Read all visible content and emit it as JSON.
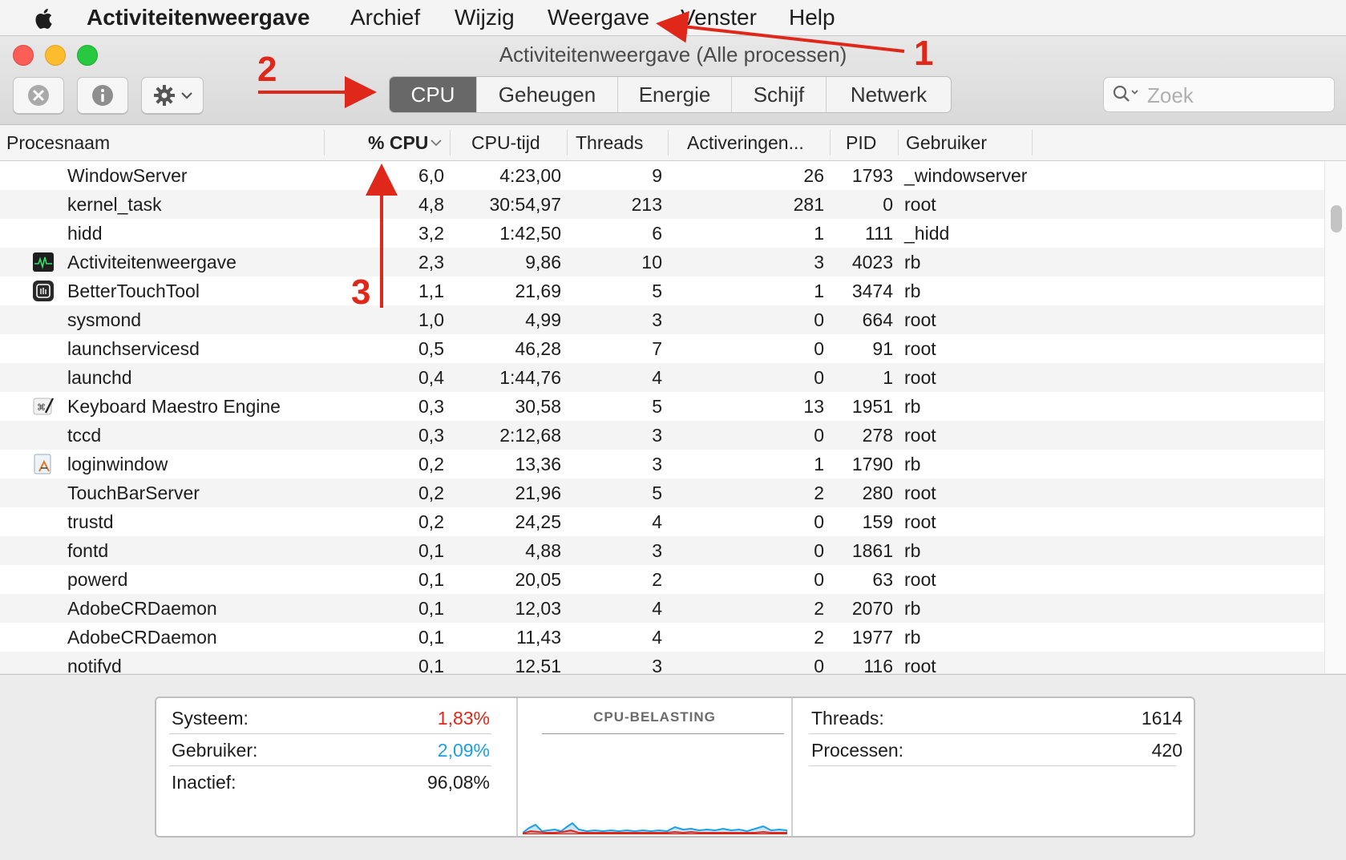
{
  "menubar": {
    "app_name": "Activiteitenweergave",
    "items": [
      "Archief",
      "Wijzig",
      "Weergave",
      "Venster",
      "Help"
    ]
  },
  "window": {
    "title": "Activiteitenweergave (Alle processen)",
    "tabs": [
      {
        "label": "CPU",
        "active": true
      },
      {
        "label": "Geheugen",
        "active": false
      },
      {
        "label": "Energie",
        "active": false
      },
      {
        "label": "Schijf",
        "active": false
      },
      {
        "label": "Netwerk",
        "active": false
      }
    ],
    "search_placeholder": "Zoek"
  },
  "table": {
    "columns": [
      "Procesnaam",
      "% CPU",
      "CPU-tijd",
      "Threads",
      "Activeringen...",
      "PID",
      "Gebruiker"
    ],
    "rows": [
      {
        "name": "WindowServer",
        "cpu": "6,0",
        "time": "4:23,00",
        "threads": "9",
        "wakeups": "26",
        "pid": "1793",
        "user": "_windowserver",
        "icon": ""
      },
      {
        "name": "kernel_task",
        "cpu": "4,8",
        "time": "30:54,97",
        "threads": "213",
        "wakeups": "281",
        "pid": "0",
        "user": "root",
        "icon": ""
      },
      {
        "name": "hidd",
        "cpu": "3,2",
        "time": "1:42,50",
        "threads": "6",
        "wakeups": "1",
        "pid": "111",
        "user": "_hidd",
        "icon": ""
      },
      {
        "name": "Activiteitenweergave",
        "cpu": "2,3",
        "time": "9,86",
        "threads": "10",
        "wakeups": "3",
        "pid": "4023",
        "user": "rb",
        "icon": "activity-monitor-icon"
      },
      {
        "name": "BetterTouchTool",
        "cpu": "1,1",
        "time": "21,69",
        "threads": "5",
        "wakeups": "1",
        "pid": "3474",
        "user": "rb",
        "icon": "bettertouchtool-icon"
      },
      {
        "name": "sysmond",
        "cpu": "1,0",
        "time": "4,99",
        "threads": "3",
        "wakeups": "0",
        "pid": "664",
        "user": "root",
        "icon": ""
      },
      {
        "name": "launchservicesd",
        "cpu": "0,5",
        "time": "46,28",
        "threads": "7",
        "wakeups": "0",
        "pid": "91",
        "user": "root",
        "icon": ""
      },
      {
        "name": "launchd",
        "cpu": "0,4",
        "time": "1:44,76",
        "threads": "4",
        "wakeups": "0",
        "pid": "1",
        "user": "root",
        "icon": ""
      },
      {
        "name": "Keyboard Maestro Engine",
        "cpu": "0,3",
        "time": "30,58",
        "threads": "5",
        "wakeups": "13",
        "pid": "1951",
        "user": "rb",
        "icon": "keyboard-maestro-icon"
      },
      {
        "name": "tccd",
        "cpu": "0,3",
        "time": "2:12,68",
        "threads": "3",
        "wakeups": "0",
        "pid": "278",
        "user": "root",
        "icon": ""
      },
      {
        "name": "loginwindow",
        "cpu": "0,2",
        "time": "13,36",
        "threads": "3",
        "wakeups": "1",
        "pid": "1790",
        "user": "rb",
        "icon": "loginwindow-icon"
      },
      {
        "name": "TouchBarServer",
        "cpu": "0,2",
        "time": "21,96",
        "threads": "5",
        "wakeups": "2",
        "pid": "280",
        "user": "root",
        "icon": ""
      },
      {
        "name": "trustd",
        "cpu": "0,2",
        "time": "24,25",
        "threads": "4",
        "wakeups": "0",
        "pid": "159",
        "user": "root",
        "icon": ""
      },
      {
        "name": "fontd",
        "cpu": "0,1",
        "time": "4,88",
        "threads": "3",
        "wakeups": "0",
        "pid": "1861",
        "user": "rb",
        "icon": ""
      },
      {
        "name": "powerd",
        "cpu": "0,1",
        "time": "20,05",
        "threads": "2",
        "wakeups": "0",
        "pid": "63",
        "user": "root",
        "icon": ""
      },
      {
        "name": "AdobeCRDaemon",
        "cpu": "0,1",
        "time": "12,03",
        "threads": "4",
        "wakeups": "2",
        "pid": "2070",
        "user": "rb",
        "icon": ""
      },
      {
        "name": "AdobeCRDaemon",
        "cpu": "0,1",
        "time": "11,43",
        "threads": "4",
        "wakeups": "2",
        "pid": "1977",
        "user": "rb",
        "icon": ""
      },
      {
        "name": "notifyd",
        "cpu": "0,1",
        "time": "12,51",
        "threads": "3",
        "wakeups": "0",
        "pid": "116",
        "user": "root",
        "icon": ""
      }
    ]
  },
  "summary": {
    "system_label": "Systeem:",
    "system_value": "1,83%",
    "system_color": "#e0281a",
    "user_label": "Gebruiker:",
    "user_value": "2,09%",
    "user_color": "#1ba0e8",
    "idle_label": "Inactief:",
    "idle_value": "96,08%",
    "graph_title": "CPU-BELASTING",
    "threads_label": "Threads:",
    "threads_value": "1614",
    "processes_label": "Processen:",
    "processes_value": "420"
  },
  "annotations": {
    "one": "1",
    "two": "2",
    "three": "3",
    "color": "#e0281a"
  }
}
